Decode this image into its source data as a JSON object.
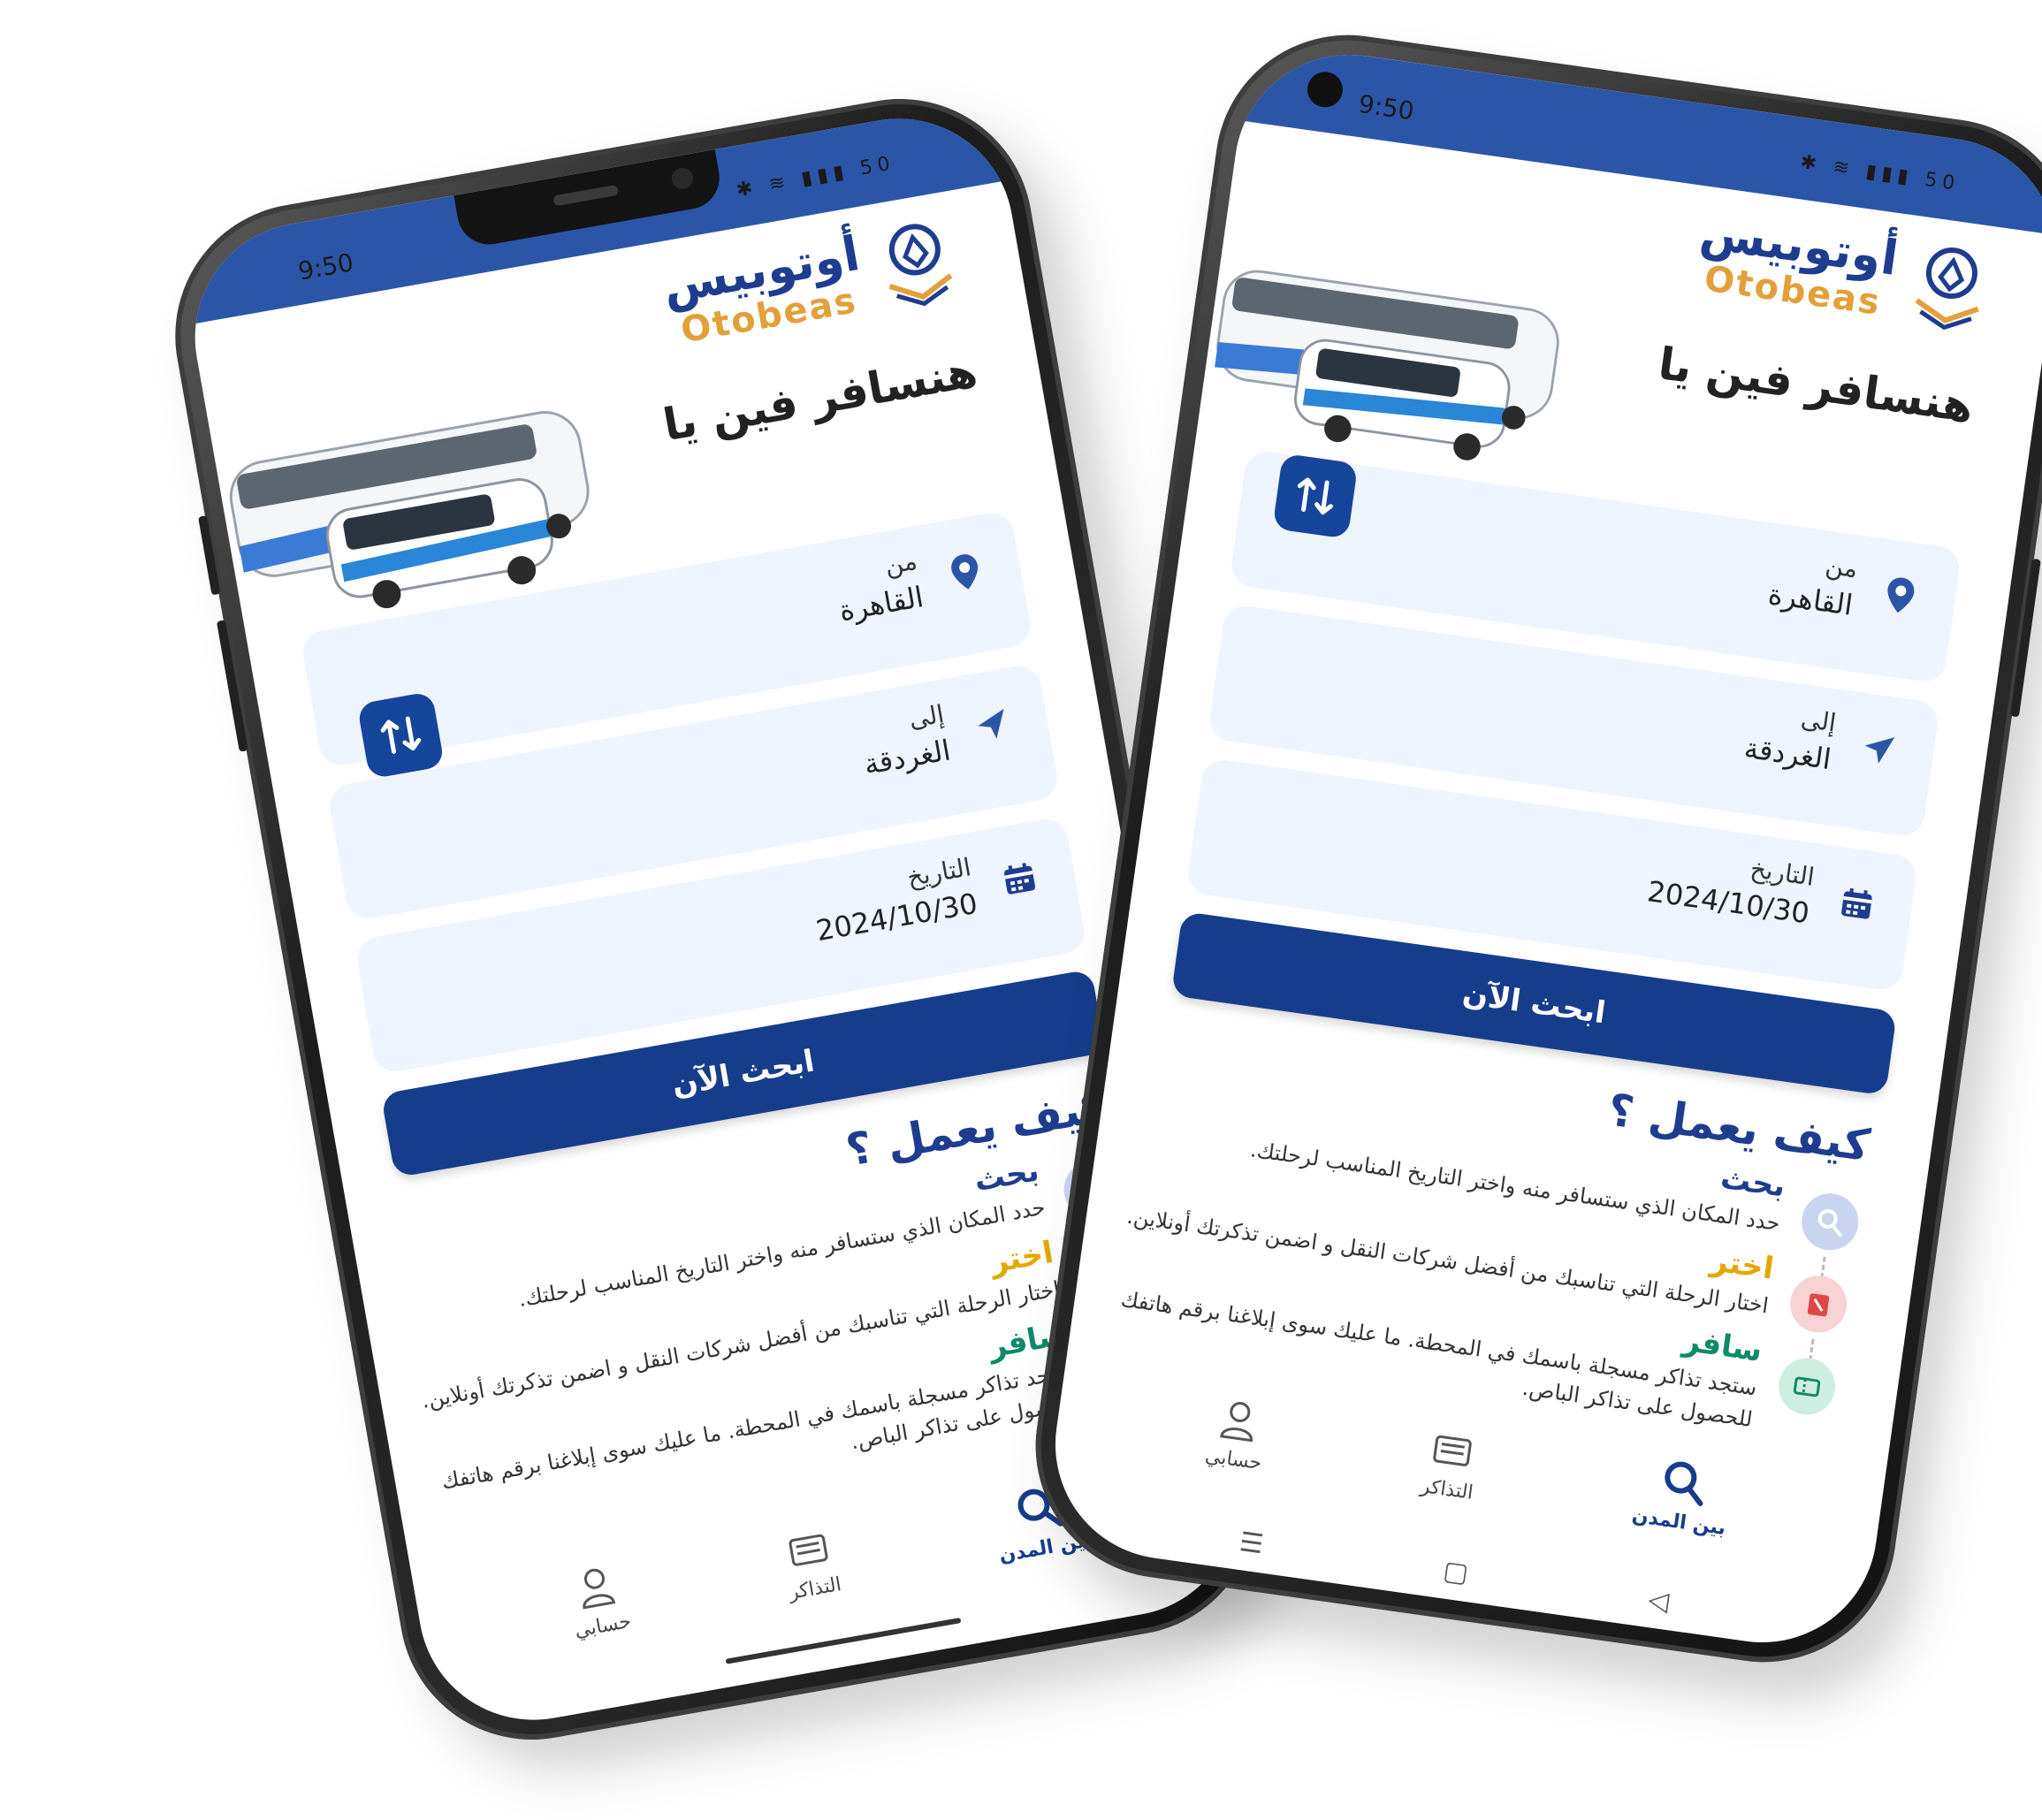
{
  "status": {
    "time": "9:50",
    "icons": "✱ ≋ ▮▮▮ 50"
  },
  "brand": {
    "name_ar": "أوتوبيس",
    "name_en": "Otobeas"
  },
  "hero": {
    "title": "هنسافر فين يا"
  },
  "form": {
    "from_label": "من",
    "from_value": "القاهرة",
    "to_label": "إلى",
    "to_value": "الغردقة",
    "date_label": "التاريخ",
    "date_value": "2024/10/30"
  },
  "search_button": "ابحث الآن",
  "how": {
    "title": "كيف يعمل ؟",
    "steps": [
      {
        "title": "بحث",
        "desc": "حدد المكان الذي ستسافر منه واختر التاريخ المناسب لرحلتك.",
        "color": "#1e3d8f"
      },
      {
        "title": "اختر",
        "desc": "اختار الرحلة التي تناسبك من أفضل شركات النقل و اضمن تذكرتك أونلاين.",
        "color": "#e3a800"
      },
      {
        "title": "سافر",
        "desc": "ستجد تذاكر مسجلة باسمك في المحطة. ما عليك سوى إبلاغنا برقم هاتفك للحصول على تذاكر الباص.",
        "color": "#0f8a6a"
      }
    ]
  },
  "tabs": {
    "intercity": "بين المدن",
    "tickets": "التذاكر",
    "account": "حسابي"
  },
  "colors": {
    "primary": "#163d8c",
    "accent": "#e3a03a",
    "status_bar": "#2b56a8",
    "card_bg": "#eef5ff"
  }
}
